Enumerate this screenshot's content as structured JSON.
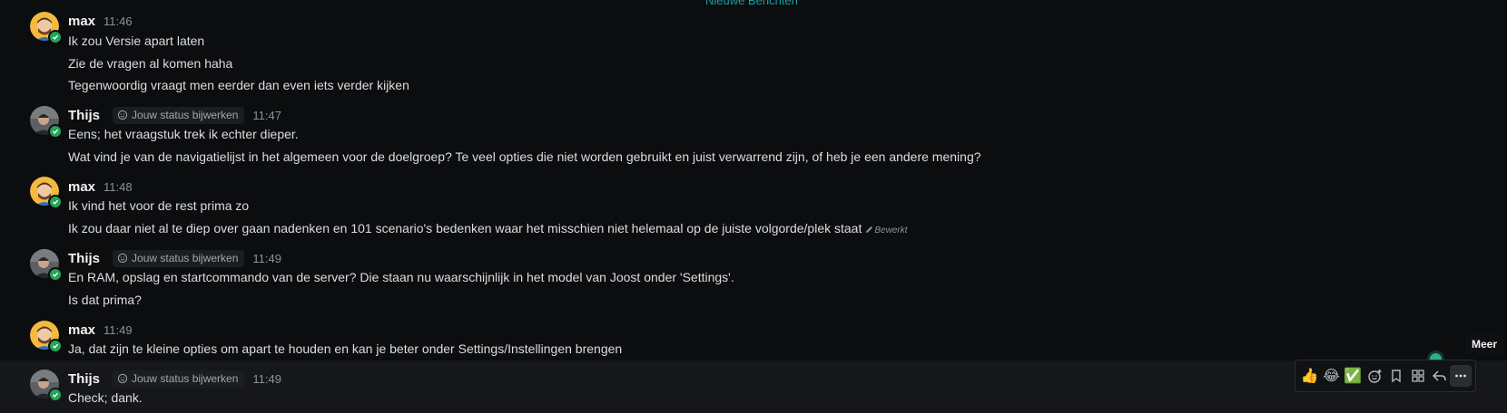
{
  "divider": {
    "new_messages_label": "Nieuwe Berichten"
  },
  "status_chip": {
    "label": "Jouw status bijwerken"
  },
  "messages": [
    {
      "author": "max",
      "time": "11:46",
      "lines": [
        "Ik zou Versie apart laten",
        "Zie de vragen al komen haha",
        "Tegenwoordig vraagt men eerder dan even iets verder kijken"
      ]
    },
    {
      "author": "Thijs",
      "time": "11:47",
      "lines": [
        "Eens; het vraagstuk trek ik echter dieper.",
        "Wat vind je van de navigatielijst in het algemeen voor de doelgroep? Te veel opties die niet worden gebruikt en juist verwarrend zijn, of heb je een andere mening?"
      ]
    },
    {
      "author": "max",
      "time": "11:48",
      "lines": [
        "Ik vind het voor de rest prima zo",
        "Ik zou daar niet al te diep over gaan nadenken en 101 scenario's bedenken waar het misschien niet helemaal op de juiste volgorde/plek staat"
      ],
      "edited_label": "Bewerkt"
    },
    {
      "author": "Thijs",
      "time": "11:49",
      "lines": [
        "En RAM, opslag en startcommando van de server? Die staan nu waarschijnlijk in het model van Joost onder 'Settings'.",
        "Is dat prima?"
      ]
    },
    {
      "author": "max",
      "time": "11:49",
      "lines": [
        "Ja, dat zijn te kleine opties om apart te houden en kan je beter onder Settings/Instellingen brengen"
      ]
    },
    {
      "author": "Thijs",
      "time": "11:49",
      "lines": [
        "Check; dank."
      ]
    }
  ],
  "toolbar": {
    "buttons": [
      {
        "icon": "thumbs-up-emoji",
        "glyph": "👍"
      },
      {
        "icon": "joy-emoji",
        "glyph": "😂"
      },
      {
        "icon": "check-mark-emoji",
        "glyph": "✅"
      },
      {
        "icon": "add-reaction-icon"
      },
      {
        "icon": "bookmark-icon"
      },
      {
        "icon": "apps-icon"
      },
      {
        "icon": "reply-icon"
      },
      {
        "icon": "more-icon"
      }
    ],
    "tooltip": "Meer"
  },
  "colors": {
    "accent": "#1e9fa3",
    "online": "#23a55a",
    "background": "#0c0d0e"
  }
}
